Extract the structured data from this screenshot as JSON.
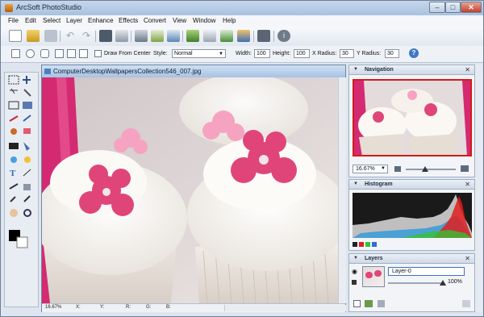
{
  "window": {
    "title": "ArcSoft PhotoStudio",
    "controls": {
      "minimize": "–",
      "maximize": "□",
      "close": "✕"
    }
  },
  "menu": [
    "File",
    "Edit",
    "Select",
    "Layer",
    "Enhance",
    "Effects",
    "Convert",
    "View",
    "Window",
    "Help"
  ],
  "toolbar": {
    "icons": [
      "new-file-icon",
      "open-icon",
      "save-icon",
      "undo-icon",
      "redo-icon",
      "scan-icon",
      "print-icon",
      "camera-icon",
      "acquire-icon",
      "export-icon",
      "photo-icon",
      "calendar-icon",
      "gallery-icon",
      "slideshow-icon",
      "compare-icon",
      "info-icon"
    ]
  },
  "options": {
    "draw_from_center": "Draw From Center",
    "style_label": "Style:",
    "style_value": "Normal",
    "width_label": "Width:",
    "width_value": "100",
    "height_label": "Height:",
    "height_value": "100",
    "xradius_label": "X Radius:",
    "xradius_value": "30",
    "yradius_label": "Y Radius:",
    "yradius_value": "30"
  },
  "document": {
    "filename": "ComputerDesktopWallpapersCollection546_007.jpg",
    "zoom": "16.67%",
    "status_labels": {
      "x": "X:",
      "y": "Y:",
      "r": "R:",
      "g": "G:",
      "b": "B:"
    }
  },
  "navigation": {
    "title": "Navigation",
    "zoom_value": "16.67%"
  },
  "histogram": {
    "title": "Histogram"
  },
  "layers": {
    "title": "Layers",
    "layer_name": "Layer-0",
    "opacity": "100%"
  },
  "colors": {
    "accent": "#3a6ea5",
    "nav_frame": "#d41a1a",
    "pink_flower": "#e0457a",
    "ribbon": "#d42a72"
  }
}
